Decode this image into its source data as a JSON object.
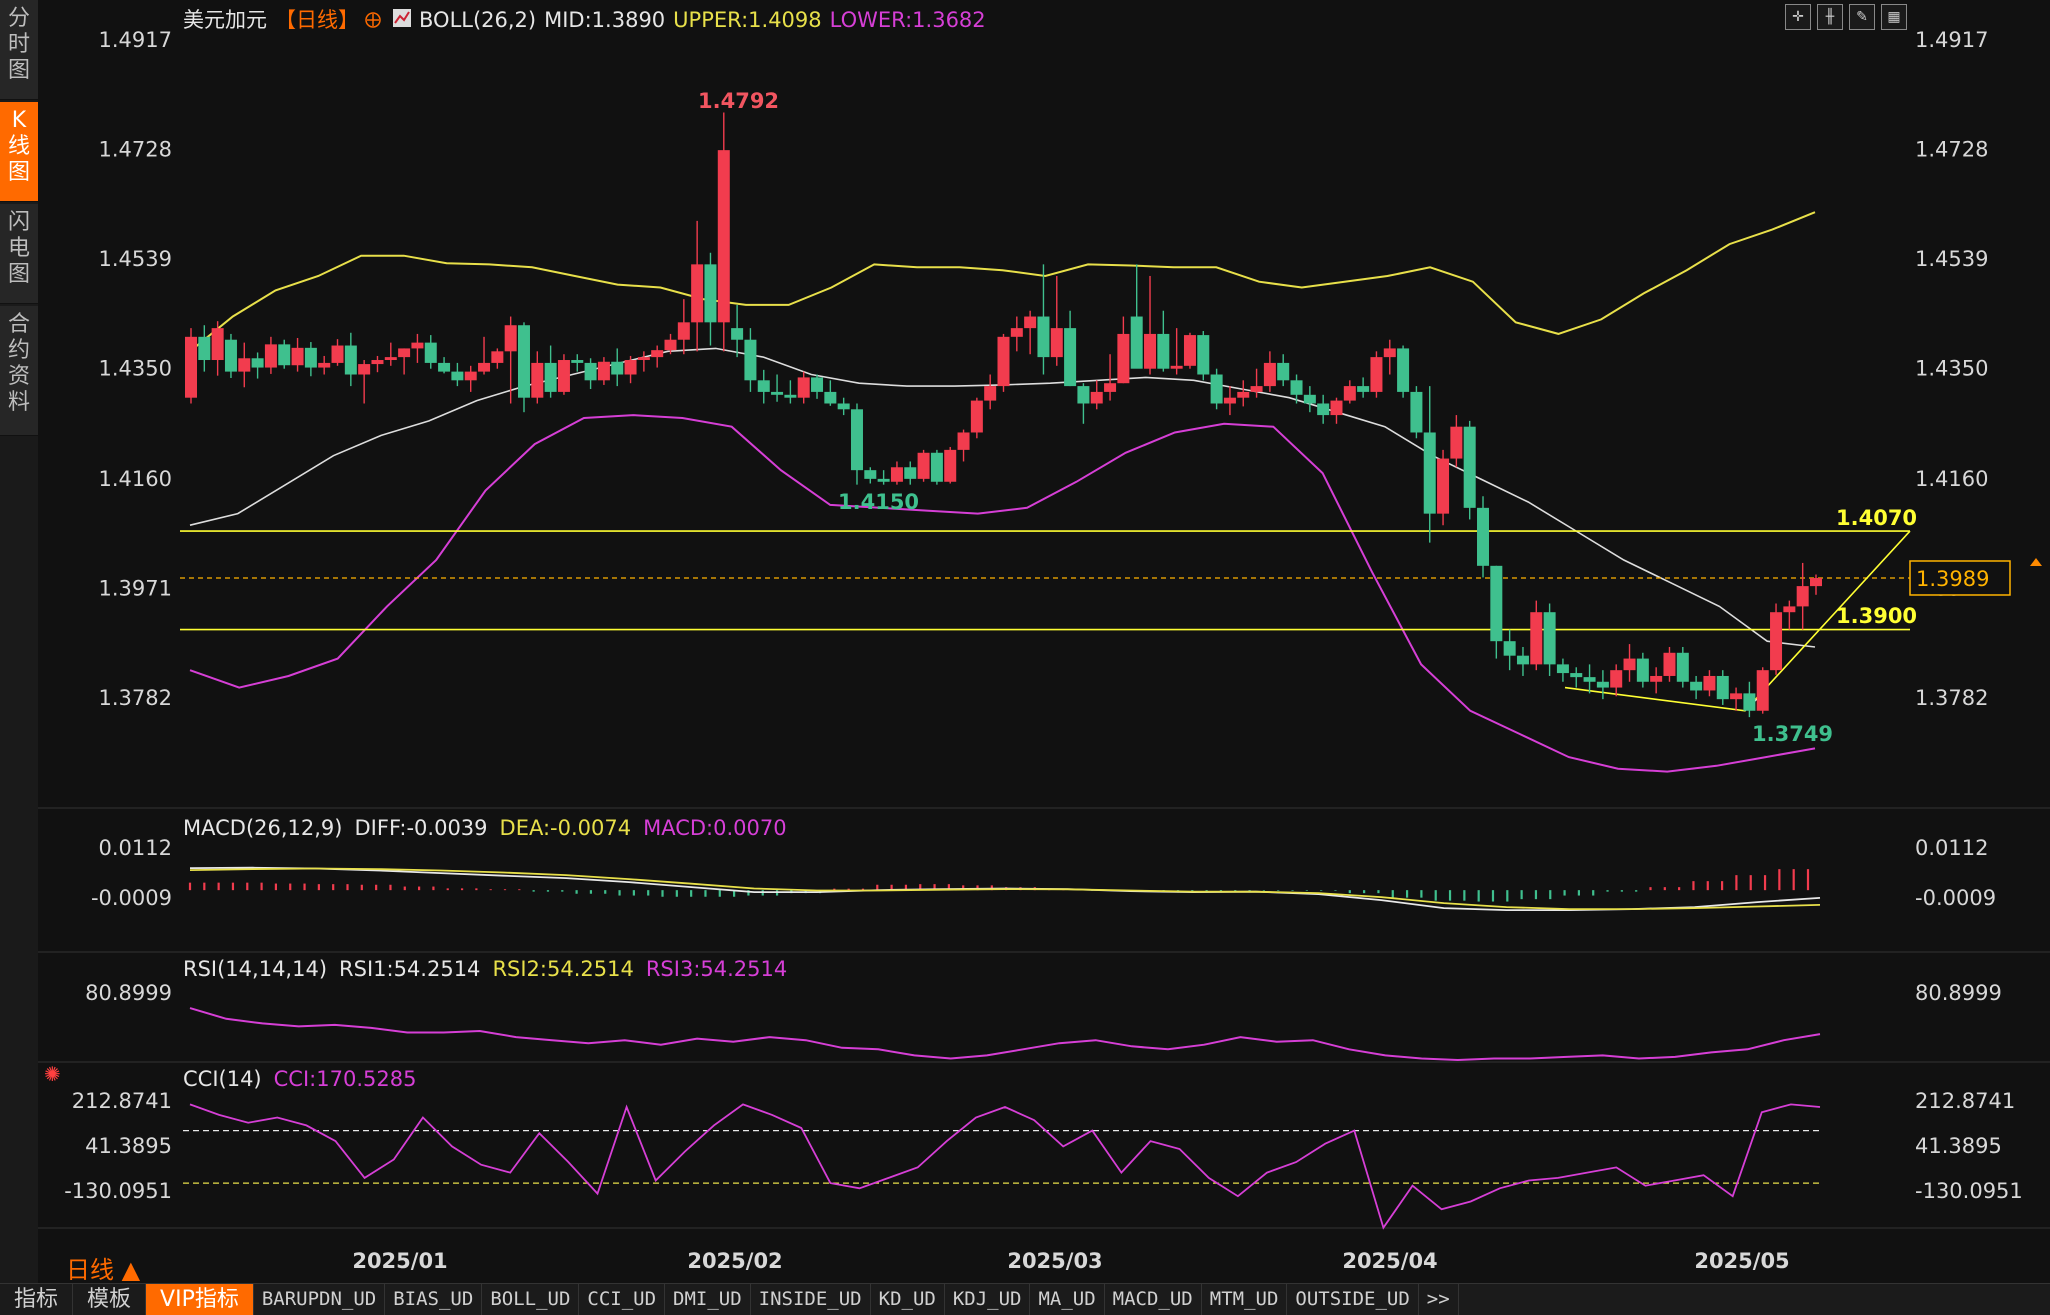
{
  "sidebar": {
    "tabs": [
      {
        "label": "分时图",
        "active": false
      },
      {
        "label": "K线图",
        "active": true
      },
      {
        "label": "闪电图",
        "active": false
      },
      {
        "label": "合约资料",
        "active": false
      }
    ]
  },
  "header": {
    "symbol": "美元加元",
    "period_tag": "【日线】",
    "add_icon": "plus-circle-icon",
    "boll": {
      "name": "BOLL(26,2)",
      "mid": "MID:1.3890",
      "upper": "UPPER:1.4098",
      "lower": "LOWER:1.3682"
    }
  },
  "toolbar": {
    "icons": [
      "crosshair-icon",
      "range-icon",
      "draw-icon",
      "indicator-icon"
    ]
  },
  "main_axis": {
    "ticks": [
      "1.4917",
      "1.4728",
      "1.4539",
      "1.4350",
      "1.4160",
      "1.3971",
      "1.3782"
    ],
    "current_price": "1.3989"
  },
  "annotations": {
    "high": "1.4792",
    "low1": "1.4150",
    "low2": "1.3749",
    "level_upper": "1.4070",
    "level_lower": "1.3900"
  },
  "macd": {
    "title": "MACD(26,12,9)",
    "diff": "DIFF:-0.0039",
    "dea": "DEA:-0.0074",
    "macd": "MACD:0.0070",
    "ticks": [
      "0.0112",
      "-0.0009"
    ]
  },
  "rsi": {
    "title": "RSI(14,14,14)",
    "rsi1": "RSI1:54.2514",
    "rsi2": "RSI2:54.2514",
    "rsi3": "RSI3:54.2514",
    "ticks": [
      "80.8999"
    ]
  },
  "cci": {
    "title": "CCI(14)",
    "cci": "CCI:170.5285",
    "ticks": [
      "212.8741",
      "41.3895",
      "-130.0951"
    ]
  },
  "x_axis": {
    "labels": [
      "2025/01",
      "2025/02",
      "2025/03",
      "2025/04",
      "2025/05"
    ]
  },
  "period_label": "日线 ▲",
  "bottom_tabs": [
    {
      "label": "指标",
      "cn": true
    },
    {
      "label": "模板",
      "cn": true
    },
    {
      "label": "VIP指标",
      "cn": true,
      "active": true
    },
    {
      "label": "BARUPDN_UD"
    },
    {
      "label": "BIAS_UD"
    },
    {
      "label": "BOLL_UD"
    },
    {
      "label": "CCI_UD"
    },
    {
      "label": "DMI_UD"
    },
    {
      "label": "INSIDE_UD"
    },
    {
      "label": "KD_UD"
    },
    {
      "label": "KDJ_UD"
    },
    {
      "label": "MA_UD"
    },
    {
      "label": "MACD_UD"
    },
    {
      "label": "MTM_UD"
    },
    {
      "label": "OUTSIDE_UD"
    },
    {
      "label": ">>"
    }
  ],
  "colors": {
    "up": "#f23c4e",
    "down": "#3fc08e",
    "upper": "#e8e04a",
    "mid": "#dddddd",
    "lower": "#d63fd6",
    "level": "#ffff33"
  },
  "chart_data": {
    "type": "candlestick",
    "title": "美元加元【日线】",
    "ylim": [
      1.37,
      1.4917
    ],
    "anchor_dates": [
      "2025/01",
      "2025/02",
      "2025/03",
      "2025/04",
      "2025/05"
    ],
    "ohlc": [
      [
        1.43,
        1.442,
        1.429,
        1.4405
      ],
      [
        1.4405,
        1.4425,
        1.4345,
        1.4365
      ],
      [
        1.4365,
        1.4432,
        1.4338,
        1.442
      ],
      [
        1.44,
        1.441,
        1.4334,
        1.4345
      ],
      [
        1.4345,
        1.4395,
        1.4318,
        1.4368
      ],
      [
        1.4368,
        1.4378,
        1.4333,
        1.4352
      ],
      [
        1.4352,
        1.4405,
        1.4341,
        1.4392
      ],
      [
        1.4392,
        1.44,
        1.435,
        1.4356
      ],
      [
        1.4356,
        1.4403,
        1.4345,
        1.4386
      ],
      [
        1.4386,
        1.4396,
        1.4337,
        1.4352
      ],
      [
        1.4352,
        1.4372,
        1.434,
        1.436
      ],
      [
        1.436,
        1.4401,
        1.4355,
        1.439
      ],
      [
        1.439,
        1.4412,
        1.432,
        1.434
      ],
      [
        1.434,
        1.4365,
        1.429,
        1.4358
      ],
      [
        1.4358,
        1.4372,
        1.4344,
        1.4365
      ],
      [
        1.4365,
        1.4395,
        1.4355,
        1.437
      ],
      [
        1.437,
        1.4385,
        1.434,
        1.4385
      ],
      [
        1.4385,
        1.441,
        1.436,
        1.4395
      ],
      [
        1.4395,
        1.4408,
        1.435,
        1.436
      ],
      [
        1.436,
        1.437,
        1.4342,
        1.4345
      ],
      [
        1.4345,
        1.436,
        1.432,
        1.433
      ],
      [
        1.433,
        1.4355,
        1.431,
        1.4345
      ],
      [
        1.4345,
        1.4405,
        1.434,
        1.436
      ],
      [
        1.436,
        1.4385,
        1.435,
        1.438
      ],
      [
        1.438,
        1.444,
        1.429,
        1.4425
      ],
      [
        1.4425,
        1.443,
        1.4275,
        1.43
      ],
      [
        1.43,
        1.438,
        1.429,
        1.436
      ],
      [
        1.436,
        1.439,
        1.43,
        1.431
      ],
      [
        1.431,
        1.4375,
        1.4305,
        1.4365
      ],
      [
        1.4365,
        1.4375,
        1.4345,
        1.436
      ],
      [
        1.436,
        1.4368,
        1.4315,
        1.433
      ],
      [
        1.433,
        1.437,
        1.4322,
        1.4362
      ],
      [
        1.4362,
        1.4385,
        1.432,
        1.434
      ],
      [
        1.434,
        1.4372,
        1.4325,
        1.4365
      ],
      [
        1.4365,
        1.438,
        1.4345,
        1.437
      ],
      [
        1.437,
        1.439,
        1.4352,
        1.4382
      ],
      [
        1.4382,
        1.441,
        1.4375,
        1.44
      ],
      [
        1.44,
        1.447,
        1.4375,
        1.443
      ],
      [
        1.443,
        1.4605,
        1.438,
        1.453
      ],
      [
        1.453,
        1.455,
        1.439,
        1.443
      ],
      [
        1.443,
        1.4792,
        1.438,
        1.4727
      ],
      [
        1.442,
        1.446,
        1.437,
        1.44
      ],
      [
        1.44,
        1.442,
        1.431,
        1.433
      ],
      [
        1.433,
        1.4348,
        1.429,
        1.431
      ],
      [
        1.431,
        1.434,
        1.4293,
        1.4305
      ],
      [
        1.4305,
        1.433,
        1.429,
        1.43
      ],
      [
        1.43,
        1.4345,
        1.429,
        1.4335
      ],
      [
        1.4335,
        1.434,
        1.4298,
        1.431
      ],
      [
        1.431,
        1.433,
        1.4286,
        1.429
      ],
      [
        1.429,
        1.43,
        1.427,
        1.428
      ],
      [
        1.428,
        1.429,
        1.415,
        1.4175
      ],
      [
        1.4175,
        1.418,
        1.4152,
        1.416
      ],
      [
        1.416,
        1.4175,
        1.415,
        1.4155
      ],
      [
        1.4155,
        1.419,
        1.415,
        1.418
      ],
      [
        1.418,
        1.419,
        1.415,
        1.416
      ],
      [
        1.416,
        1.421,
        1.4155,
        1.4205
      ],
      [
        1.4205,
        1.421,
        1.415,
        1.4155
      ],
      [
        1.4155,
        1.4215,
        1.4152,
        1.421
      ],
      [
        1.421,
        1.4245,
        1.419,
        1.424
      ],
      [
        1.424,
        1.43,
        1.423,
        1.4295
      ],
      [
        1.4295,
        1.434,
        1.428,
        1.432
      ],
      [
        1.432,
        1.441,
        1.431,
        1.4405
      ],
      [
        1.4405,
        1.444,
        1.438,
        1.442
      ],
      [
        1.442,
        1.445,
        1.4375,
        1.444
      ],
      [
        1.444,
        1.453,
        1.434,
        1.437
      ],
      [
        1.437,
        1.451,
        1.4355,
        1.442
      ],
      [
        1.442,
        1.445,
        1.432,
        1.432
      ],
      [
        1.432,
        1.4325,
        1.4255,
        1.429
      ],
      [
        1.429,
        1.433,
        1.428,
        1.431
      ],
      [
        1.431,
        1.4375,
        1.4295,
        1.4325
      ],
      [
        1.4325,
        1.444,
        1.4325,
        1.441
      ],
      [
        1.444,
        1.453,
        1.44,
        1.435
      ],
      [
        1.435,
        1.451,
        1.434,
        1.441
      ],
      [
        1.441,
        1.445,
        1.4345,
        1.435
      ],
      [
        1.435,
        1.442,
        1.434,
        1.4355
      ],
      [
        1.4355,
        1.4412,
        1.435,
        1.4408
      ],
      [
        1.4408,
        1.4415,
        1.433,
        1.434
      ],
      [
        1.434,
        1.435,
        1.428,
        1.429
      ],
      [
        1.429,
        1.432,
        1.427,
        1.43
      ],
      [
        1.43,
        1.433,
        1.4285,
        1.431
      ],
      [
        1.431,
        1.435,
        1.43,
        1.432
      ],
      [
        1.432,
        1.438,
        1.431,
        1.436
      ],
      [
        1.436,
        1.4375,
        1.432,
        1.433
      ],
      [
        1.433,
        1.434,
        1.429,
        1.4305
      ],
      [
        1.4305,
        1.432,
        1.4275,
        1.429
      ],
      [
        1.429,
        1.4305,
        1.4255,
        1.427
      ],
      [
        1.427,
        1.43,
        1.4255,
        1.4295
      ],
      [
        1.4295,
        1.433,
        1.429,
        1.432
      ],
      [
        1.432,
        1.4335,
        1.43,
        1.431
      ],
      [
        1.431,
        1.438,
        1.43,
        1.437
      ],
      [
        1.437,
        1.44,
        1.434,
        1.4385
      ],
      [
        1.4385,
        1.439,
        1.43,
        1.431
      ],
      [
        1.431,
        1.432,
        1.423,
        1.424
      ],
      [
        1.424,
        1.432,
        1.405,
        1.41
      ],
      [
        1.41,
        1.421,
        1.408,
        1.4195
      ],
      [
        1.4195,
        1.427,
        1.418,
        1.425
      ],
      [
        1.425,
        1.426,
        1.409,
        1.411
      ],
      [
        1.411,
        1.413,
        1.399,
        1.401
      ],
      [
        1.401,
        1.401,
        1.385,
        1.388
      ],
      [
        1.388,
        1.39,
        1.383,
        1.3855
      ],
      [
        1.3855,
        1.387,
        1.382,
        1.384
      ],
      [
        1.384,
        1.395,
        1.383,
        1.393
      ],
      [
        1.393,
        1.3945,
        1.382,
        1.384
      ],
      [
        1.384,
        1.385,
        1.381,
        1.3825
      ],
      [
        1.3825,
        1.3835,
        1.38,
        1.3818
      ],
      [
        1.3818,
        1.384,
        1.379,
        1.381
      ],
      [
        1.381,
        1.383,
        1.378,
        1.38
      ],
      [
        1.38,
        1.384,
        1.3785,
        1.383
      ],
      [
        1.383,
        1.3875,
        1.381,
        1.385
      ],
      [
        1.385,
        1.386,
        1.38,
        1.381
      ],
      [
        1.381,
        1.3835,
        1.379,
        1.382
      ],
      [
        1.382,
        1.387,
        1.381,
        1.386
      ],
      [
        1.386,
        1.387,
        1.38,
        1.381
      ],
      [
        1.381,
        1.382,
        1.378,
        1.3795
      ],
      [
        1.3795,
        1.383,
        1.3785,
        1.382
      ],
      [
        1.382,
        1.383,
        1.377,
        1.378
      ],
      [
        1.378,
        1.38,
        1.376,
        1.379
      ],
      [
        1.379,
        1.381,
        1.3749,
        1.376
      ],
      [
        1.376,
        1.3835,
        1.3755,
        1.383
      ],
      [
        1.383,
        1.3945,
        1.3822,
        1.393
      ],
      [
        1.393,
        1.395,
        1.39,
        1.394
      ],
      [
        1.394,
        1.4015,
        1.39,
        1.3975
      ],
      [
        1.3975,
        1.3995,
        1.396,
        1.3989
      ]
    ],
    "boll_upper": [
      1.438,
      1.444,
      1.4485,
      1.451,
      1.4545,
      1.4545,
      1.4532,
      1.453,
      1.4525,
      1.451,
      1.4495,
      1.449,
      1.447,
      1.446,
      1.446,
      1.449,
      1.453,
      1.4525,
      1.4525,
      1.452,
      1.451,
      1.453,
      1.4528,
      1.4525,
      1.4525,
      1.45,
      1.449,
      1.45,
      1.451,
      1.4525,
      1.45,
      1.443,
      1.441,
      1.4435,
      1.448,
      1.452,
      1.4565,
      1.459,
      1.462
    ],
    "boll_mid": [
      1.408,
      1.41,
      1.415,
      1.42,
      1.4235,
      1.426,
      1.4295,
      1.432,
      1.434,
      1.436,
      1.438,
      1.4385,
      1.437,
      1.434,
      1.4325,
      1.432,
      1.432,
      1.4322,
      1.4325,
      1.433,
      1.4335,
      1.433,
      1.4315,
      1.43,
      1.4275,
      1.425,
      1.42,
      1.416,
      1.412,
      1.407,
      1.402,
      1.398,
      1.394,
      1.388,
      1.387
    ],
    "boll_lower": [
      1.383,
      1.38,
      1.382,
      1.385,
      1.394,
      1.402,
      1.414,
      1.422,
      1.4265,
      1.427,
      1.4265,
      1.425,
      1.4175,
      1.4115,
      1.411,
      1.4105,
      1.41,
      1.411,
      1.4155,
      1.4205,
      1.424,
      1.4255,
      1.425,
      1.417,
      1.4,
      1.384,
      1.376,
      1.372,
      1.368,
      1.366,
      1.3655,
      1.3665,
      1.368,
      1.3695
    ],
    "levels": [
      1.407,
      1.39
    ],
    "macd": {
      "diff": [
        0.011,
        0.0112,
        0.0108,
        0.0098,
        0.0085,
        0.0072,
        0.006,
        0.004,
        0.0015,
        -0.001,
        -0.001,
        -0.0,
        0.0005,
        0.0008,
        0.0005,
        -0.0005,
        -0.001,
        -0.0008,
        -0.002,
        -0.005,
        -0.009,
        -0.01,
        -0.01,
        -0.0095,
        -0.0085,
        -0.006,
        -0.0039
      ],
      "dea": [
        0.01,
        0.0105,
        0.0108,
        0.0105,
        0.0098,
        0.0088,
        0.0075,
        0.0055,
        0.0032,
        0.0008,
        -0.0002,
        -0.0002,
        0.0002,
        0.0005,
        0.0004,
        -0.0002,
        -0.0008,
        -0.0008,
        -0.0015,
        -0.0035,
        -0.0065,
        -0.0085,
        -0.0095,
        -0.0095,
        -0.009,
        -0.0082,
        -0.0074
      ],
      "hist": [
        0.0025,
        0.0025,
        0.0022,
        0.002,
        0.0018,
        0.0012,
        0.0006,
        0.0003,
        -0.0005,
        -0.0012,
        -0.0018,
        -0.0022,
        -0.0022,
        -0.0018,
        -0.001,
        0.0005,
        0.0018,
        0.002,
        0.0016,
        0.001,
        0.0004,
        -0.0002,
        -0.0005,
        -0.0008,
        -0.0005,
        -0.0002,
        -0.0002,
        -0.001,
        -0.0025,
        -0.0035,
        -0.0038,
        -0.003,
        -0.0018,
        -0.0005,
        0.001,
        0.003,
        0.005,
        0.007
      ]
    },
    "rsi": [
      71,
      64,
      61,
      59,
      60,
      58,
      55,
      55,
      56,
      52,
      50,
      48,
      50,
      47,
      51,
      49,
      52,
      50,
      45,
      44,
      40,
      38,
      40,
      44,
      48,
      50,
      46,
      44,
      47,
      52,
      49,
      50,
      44,
      40,
      38,
      37,
      38,
      38,
      39,
      40,
      38,
      39,
      42,
      44,
      50,
      54
    ],
    "cci": [
      200,
      160,
      130,
      150,
      120,
      60,
      -80,
      -10,
      150,
      40,
      -30,
      -60,
      90,
      -20,
      -140,
      190,
      -90,
      20,
      120,
      200,
      160,
      110,
      -100,
      -120,
      -80,
      -40,
      60,
      150,
      190,
      140,
      40,
      100,
      -60,
      60,
      30,
      -80,
      -150,
      -60,
      -20,
      50,
      100,
      -270,
      -110,
      -200,
      -170,
      -120,
      -90,
      -80,
      -60,
      -40,
      -110,
      -90,
      -70,
      -150,
      170,
      200,
      190
    ]
  }
}
